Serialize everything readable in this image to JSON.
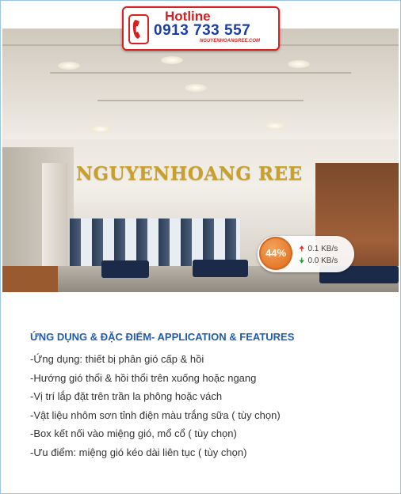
{
  "hotline": {
    "label": "Hotline",
    "number": "0913 733 557",
    "website": "NGUYENHOANGREE.COM"
  },
  "hero": {
    "brand_text": "NGUYENHOANG REE"
  },
  "network_widget": {
    "percent": "44%",
    "upload_rate": "0.1 KB/s",
    "download_rate": "0.0 KB/s"
  },
  "content": {
    "title": "ỨNG DỤNG & ĐẶC ĐIỂM- APPLICATION & FEATURES",
    "features": [
      "-Ứng dụng: thiết bị phân gió cấp & hồi",
      "-Hướng gió thổi & hồi thổi trên xuống hoặc ngang",
      "-Vị trí  lắp đặt trên trần la phông hoặc vách",
      "-Vật liệu nhôm sơn tỉnh điện màu trắng sữa ( tùy chọn)",
      "-Box kết nối vào miệng gió, mổ cổ ( tùy chọn)",
      "-Ưu điểm: miệng gió kéo dài liên tục ( tùy chọn)"
    ]
  },
  "colors": {
    "hotline_red": "#d81e1e",
    "hotline_blue": "#1a3ea8",
    "brand_gold": "#c9a02a",
    "title_blue": "#1f5bb3",
    "gauge_orange": "#e6772a"
  },
  "icons": {
    "phone": "phone-icon",
    "upload": "arrow-up-icon",
    "download": "arrow-down-icon"
  }
}
